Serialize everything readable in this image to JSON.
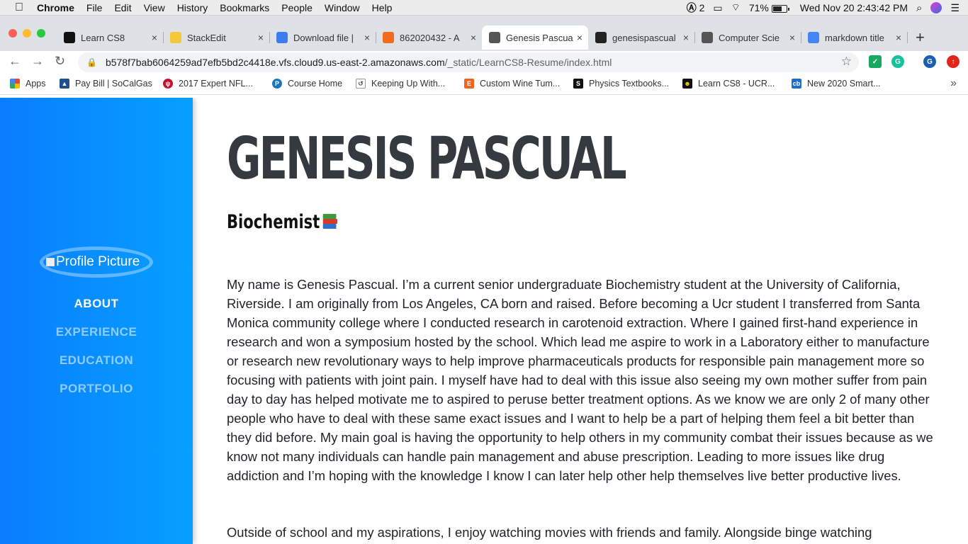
{
  "menubar": {
    "app": "Chrome",
    "items": [
      "File",
      "Edit",
      "View",
      "History",
      "Bookmarks",
      "People",
      "Window",
      "Help"
    ],
    "adobe_count": "2",
    "battery": "71%",
    "battery_level": 0.71,
    "clock": "Wed Nov 20  2:43:42 PM"
  },
  "tabs": [
    {
      "title": "Learn CS8",
      "icon": "learncs8-icon",
      "color": "#111111"
    },
    {
      "title": "StackEdit",
      "icon": "stackedit-icon",
      "color": "#f3c93b"
    },
    {
      "title": "Download file |",
      "icon": "dropbox-icon",
      "color": "#3d7cf0"
    },
    {
      "title": "862020432 - A",
      "icon": "box-icon",
      "color": "#f26a1b"
    },
    {
      "title": "Genesis Pascual",
      "icon": "globe-icon",
      "color": "#555555",
      "active": true
    },
    {
      "title": "genesispascual",
      "icon": "github-icon",
      "color": "#222222"
    },
    {
      "title": "Computer Scie",
      "icon": "globe-icon",
      "color": "#555555"
    },
    {
      "title": "markdown title",
      "icon": "google-icon",
      "color": "#4285f4"
    }
  ],
  "address": {
    "host": "b578f7bab6064259ad7efb5bd2c4418e.vfs.cloud9.us-east-2.amazonaws.com",
    "path": "/_static/LearnCS8-Resume/index.html"
  },
  "bookmarks": [
    {
      "label": "Apps"
    },
    {
      "label": "Pay Bill | SoCalGas"
    },
    {
      "label": "2017 Expert NFL..."
    },
    {
      "label": "Course Home"
    },
    {
      "label": "Keeping Up With..."
    },
    {
      "label": "Custom Wine Tum..."
    },
    {
      "label": "Physics Textbooks..."
    },
    {
      "label": "Learn CS8 - UCR..."
    },
    {
      "label": "New 2020 Smart..."
    }
  ],
  "profile": {
    "alt": "Profile Picture"
  },
  "nav": [
    "ABOUT",
    "EXPERIENCE",
    "EDUCATION",
    "PORTFOLIO"
  ],
  "name": "GENESIS PASCUAL",
  "subtitle": "Biochemist",
  "paragraphs": [
    "My name is Genesis Pascual. I’m a current senior undergraduate Biochemistry student at the University of California, Riverside. I am originally from Los Angeles, CA born and raised. Before becoming a Ucr student I transferred from Santa Monica community college where I conducted research in carotenoid extraction. Where I gained first-hand experience in research and won a symposium hosted by the school. Which lead me aspire to work in a Laboratory either to manufacture or research new revolutionary ways to help improve pharmaceuticals products for responsible pain management more so focusing with patients with joint pain. I myself have had to deal with this issue also seeing my own mother suffer from pain day to day has helped motivate me to aspired to peruse better treatment options. As we know we are only 2 of many other people who have to deal with these same exact issues and I want to help be a part of helping them feel a bit better than they did before. My main goal is having the opportunity to help others in my community combat their issues because as we know not many individuals can handle pain management and abuse prescription. Leading to more issues like drug addiction and I’m hoping with the knowledge I know I can later help other help themselves live better productive lives.",
    "Outside of school and my aspirations, I enjoy watching movies with friends and family. Alongside binge watching"
  ]
}
